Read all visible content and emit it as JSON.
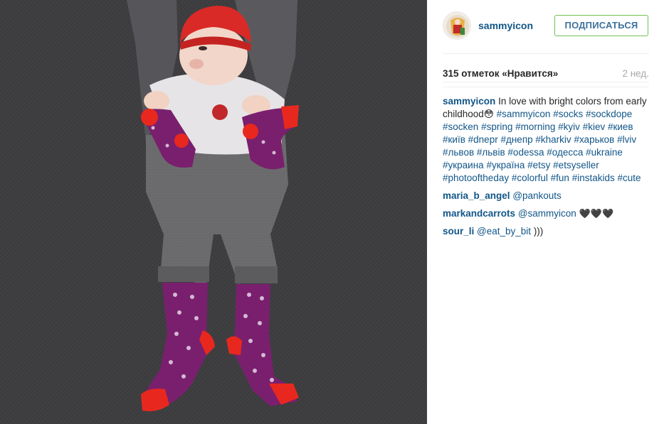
{
  "post": {
    "username": "sammyicon",
    "follow_label": "ПОДПИСАТЬСЯ",
    "likes": "315 отметок «Нравится»",
    "time_ago": "2 нед."
  },
  "caption": {
    "username": "sammyicon",
    "text": "In love with bright colors from early childhood",
    "emoji": "😳",
    "hashtags": [
      "#sammyicon",
      "#socks",
      "#sockdope",
      "#socken",
      "#spring",
      "#morning",
      "#kyiv",
      "#kiev",
      "#киев",
      "#київ",
      "#dnepr",
      "#днепр",
      "#kharkiv",
      "#харьков",
      "#lviv",
      "#львов",
      "#львів",
      "#odessa",
      "#одесса",
      "#ukraine",
      "#украина",
      "#україна",
      "#etsy",
      "#etsyseller",
      "#photooftheday",
      "#colorful",
      "#fun",
      "#instakids",
      "#cute"
    ]
  },
  "comments": [
    {
      "username": "maria_b_angel",
      "mention": "@pankouts",
      "text": ""
    },
    {
      "username": "markandcarrots",
      "mention": "@sammyicon",
      "text": "🖤🖤🖤"
    },
    {
      "username": "sour_li",
      "mention": "@eat_by_bit",
      "text": ")))"
    }
  ],
  "colors": {
    "link": "#125688",
    "follow_border": "#70c050",
    "follow_text": "#3f729b",
    "muted": "#a5a7aa",
    "sock_purple": "#7a1f6e",
    "sock_red": "#e8281e",
    "hat_red": "#d92a27"
  },
  "icons": {
    "avatar": "avatar-image"
  }
}
